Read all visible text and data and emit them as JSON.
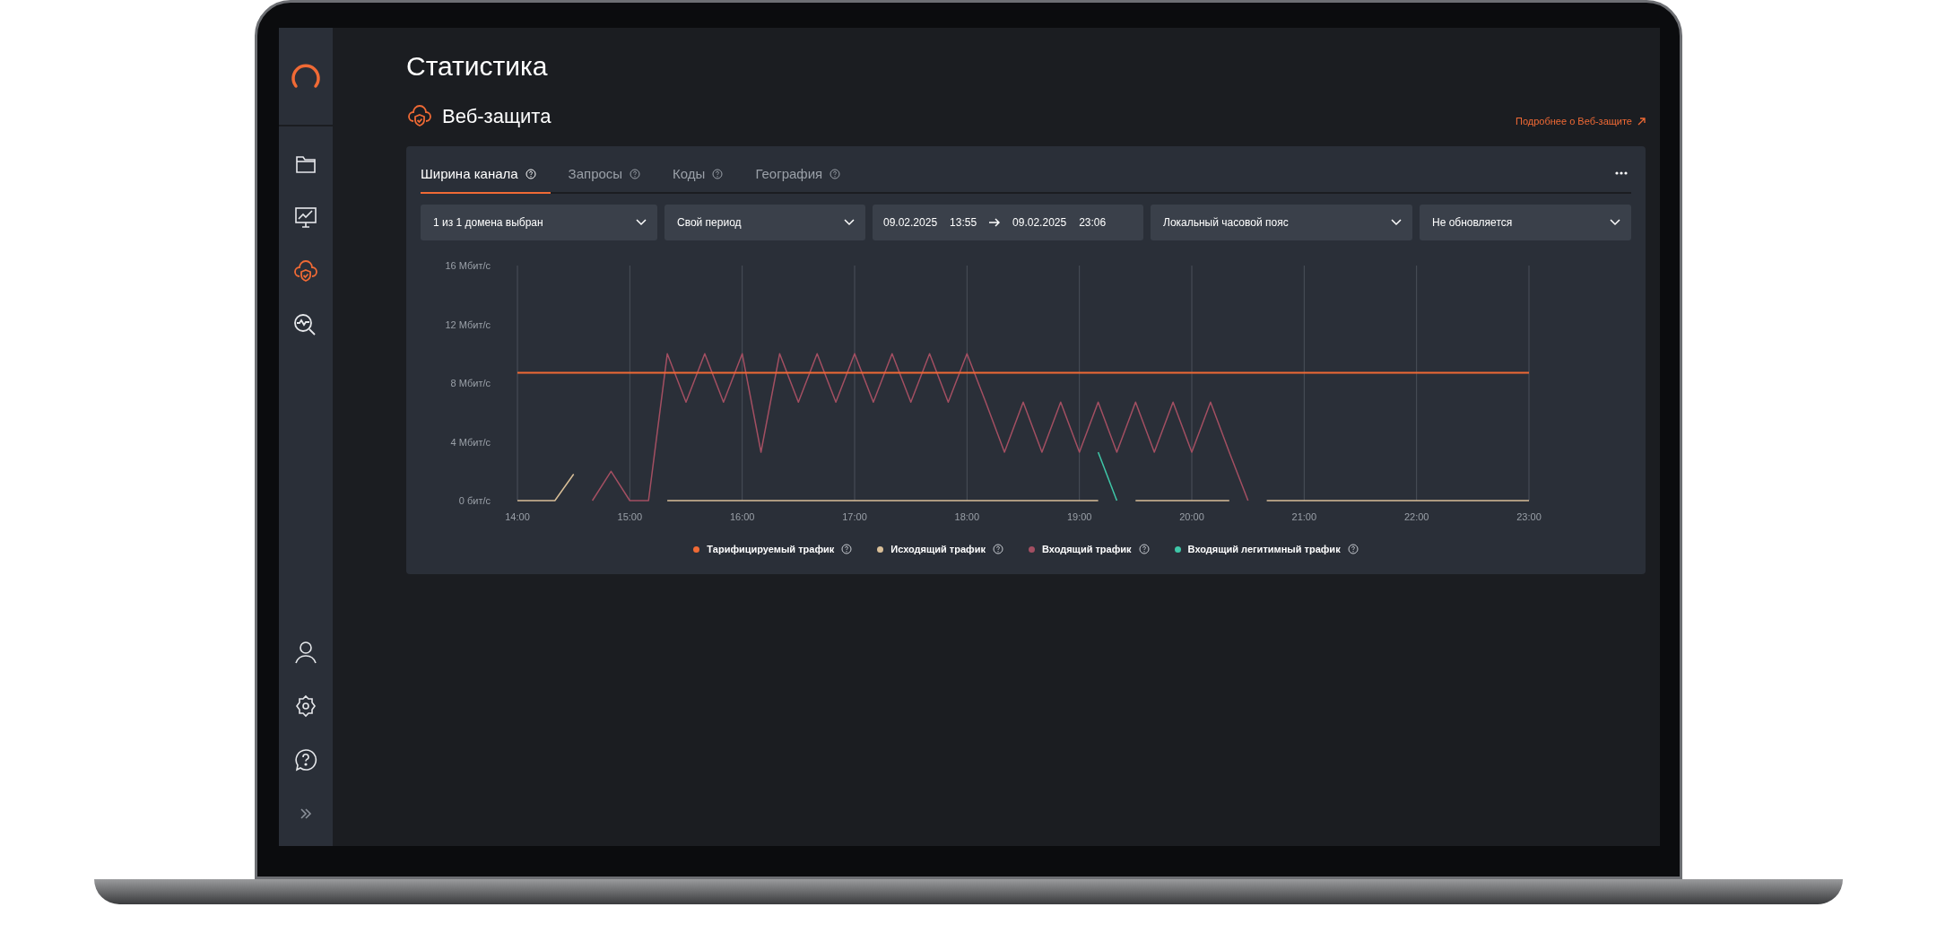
{
  "sidebar": {
    "top_items": [
      {
        "selected": false
      },
      {
        "selected": false
      },
      {
        "selected": true
      },
      {
        "selected": false
      }
    ],
    "bottom_items": [
      {
        "selected": false
      },
      {
        "selected": false
      },
      {
        "selected": false
      }
    ]
  },
  "page": {
    "title": "Статистика",
    "section_title": "Веб-защита",
    "more_link": "Подробнее о Веб-защите"
  },
  "tabs": [
    {
      "label": "Ширина канала",
      "selected": true
    },
    {
      "label": "Запросы",
      "selected": false
    },
    {
      "label": "Коды",
      "selected": false
    },
    {
      "label": "География",
      "selected": false
    }
  ],
  "filters": [
    {
      "kind": "dropdown",
      "value": "1 из 1 домена выбран"
    },
    {
      "kind": "dropdown",
      "value": "Свой период"
    },
    {
      "kind": "daterange",
      "start_date": "09.02.2025",
      "start_time": "13:55",
      "end_date": "09.02.2025",
      "end_time": "23:06"
    },
    {
      "kind": "dropdown",
      "value": "Локальный часовой пояс"
    },
    {
      "kind": "dropdown",
      "value": "Не обновляется"
    }
  ],
  "chart": {
    "chart_data": {
      "type": "line",
      "grid": true,
      "xlim": [
        14,
        23
      ],
      "ylim": [
        0,
        16
      ],
      "x": [
        14,
        14.1667,
        14.3333,
        14.5,
        14.6667,
        14.8333,
        15,
        15.1667,
        15.3333,
        15.5,
        15.6667,
        15.8333,
        16,
        16.1667,
        16.3333,
        16.5,
        16.6667,
        16.8333,
        17,
        17.1667,
        17.3333,
        17.5,
        17.6667,
        17.8333,
        18,
        18.1667,
        18.3333,
        18.5,
        18.6667,
        18.8333,
        19,
        19.1667,
        19.3333,
        19.5,
        19.6667,
        19.8333,
        20,
        20.1667,
        20.3333,
        20.5,
        20.6667,
        20.8333,
        21,
        21.1667,
        21.3333,
        21.5,
        21.6667,
        21.8333,
        22,
        22.1667,
        22.3333,
        22.5,
        22.6667,
        22.8333,
        23
      ],
      "xticks": [
        {
          "value": 14,
          "label": "14:00"
        },
        {
          "value": 15,
          "label": "15:00"
        },
        {
          "value": 16,
          "label": "16:00"
        },
        {
          "value": 17,
          "label": "17:00"
        },
        {
          "value": 18,
          "label": "18:00"
        },
        {
          "value": 19,
          "label": "19:00"
        },
        {
          "value": 20,
          "label": "20:00"
        },
        {
          "value": 21,
          "label": "21:00"
        },
        {
          "value": 22,
          "label": "22:00"
        },
        {
          "value": 23,
          "label": "23:00"
        }
      ],
      "yticks": [
        {
          "value": 0,
          "label": "0 бит/с"
        },
        {
          "value": 4,
          "label": "4 Мбит/с"
        },
        {
          "value": 8,
          "label": "8 Мбит/с"
        },
        {
          "value": 12,
          "label": "12 Мбит/с"
        },
        {
          "value": 16,
          "label": "16 Мбит/с"
        }
      ],
      "series": [
        {
          "name": "Тарифицируемый трафик",
          "color": "#f06a35",
          "values": [
            8.7,
            8.7,
            8.7,
            8.7,
            8.7,
            8.7,
            8.7,
            8.7,
            8.7,
            8.7,
            8.7,
            8.7,
            8.7,
            8.7,
            8.7,
            8.7,
            8.7,
            8.7,
            8.7,
            8.7,
            8.7,
            8.7,
            8.7,
            8.7,
            8.7,
            8.7,
            8.7,
            8.7,
            8.7,
            8.7,
            8.7,
            8.7,
            8.7,
            8.7,
            8.7,
            8.7,
            8.7,
            8.7,
            8.7,
            8.7,
            8.7,
            8.7,
            8.7,
            8.7,
            8.7,
            8.7,
            8.7,
            8.7,
            8.7,
            8.7,
            8.7,
            8.7,
            8.7,
            8.7,
            8.7
          ]
        },
        {
          "name": "Исходящий трафик",
          "color": "#d9bf98",
          "values": [
            0,
            0,
            0,
            1.8,
            null,
            null,
            null,
            null,
            0,
            0,
            0,
            0,
            0,
            0,
            0,
            0,
            0,
            0,
            0,
            0,
            0,
            0,
            0,
            0,
            0,
            0,
            0,
            0,
            0,
            0,
            0,
            0,
            null,
            0,
            0,
            0,
            0,
            0,
            0,
            null,
            0,
            0,
            0,
            0,
            0,
            0,
            0,
            0,
            0,
            0,
            0,
            0,
            0,
            0,
            0
          ]
        },
        {
          "name": "Входящий трафик",
          "color": "#a34f62",
          "values": [
            null,
            null,
            null,
            null,
            0,
            2,
            0,
            0,
            10,
            6.7,
            10,
            6.7,
            10,
            3.3,
            10,
            6.7,
            10,
            6.7,
            10,
            6.7,
            10,
            6.7,
            10,
            6.7,
            10,
            6.7,
            3.3,
            6.7,
            3.3,
            6.7,
            3.3,
            6.7,
            3.3,
            6.7,
            3.3,
            6.7,
            3.3,
            6.7,
            3.3,
            0,
            null,
            null,
            null,
            null,
            null,
            null,
            null,
            null,
            null,
            null,
            null,
            null,
            null,
            null,
            null
          ]
        },
        {
          "name": "Входящий легитимный трафик",
          "color": "#3fc7a8",
          "values": [
            null,
            null,
            null,
            null,
            null,
            null,
            null,
            null,
            null,
            null,
            null,
            null,
            null,
            null,
            null,
            null,
            null,
            null,
            null,
            null,
            null,
            null,
            null,
            null,
            null,
            null,
            null,
            null,
            null,
            null,
            null,
            3.3,
            0,
            null,
            null,
            null,
            null,
            null,
            null,
            null,
            null,
            null,
            null,
            null,
            null,
            null,
            null,
            null,
            null,
            null,
            null,
            null,
            null,
            null,
            null
          ]
        }
      ]
    }
  }
}
